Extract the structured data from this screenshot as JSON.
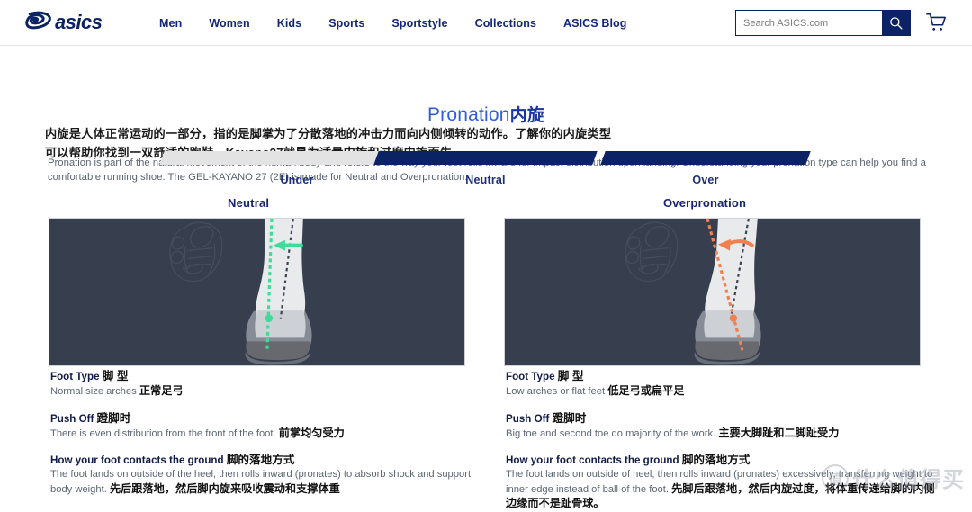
{
  "header": {
    "logo_text": "asics",
    "nav": [
      {
        "label": "Men"
      },
      {
        "label": "Women"
      },
      {
        "label": "Kids"
      },
      {
        "label": "Sports"
      },
      {
        "label": "Sportstyle"
      },
      {
        "label": "Collections"
      },
      {
        "label": "ASICS Blog"
      }
    ],
    "search": {
      "placeholder": "Search ASICS.com",
      "value": ""
    },
    "cart_label": "Cart",
    "colors": {
      "navy": "#0b2265",
      "nav_text": "#14267a"
    }
  },
  "title": {
    "en": "Pronation",
    "cn": "内旋",
    "cn_lead": "内旋是人体正常运动的一部分，指的是脚掌为了分散落地的冲击力而向内侧倾转的动作。了解你的内旋类型可以帮助你找到一双舒适的跑鞋。Kayano27就是为适量内旋和过度内旋而生。",
    "en_lead": "Pronation is part of the natural movement of the human body and refers to the way your foot rolls inward for impact distribution upon landing. Understanding your pronation type can help you find a comfortable running shoe. The GEL-KAYANO 27 (2E) is made for Neutral and Overpronation."
  },
  "scale": {
    "items": [
      {
        "label": "Under",
        "active": false,
        "color": "#e3e3e3"
      },
      {
        "label": "Neutral",
        "active": true,
        "color": "#0b2265"
      },
      {
        "label": "Over",
        "active": true,
        "color": "#0b2265"
      }
    ]
  },
  "columns": [
    {
      "heading": "Neutral",
      "accent": "#3ddc97",
      "blocks": [
        {
          "title_en": "Foot Type",
          "title_cn": "脚 型",
          "body_en": "Normal size arches",
          "body_cn": "正常足弓"
        },
        {
          "title_en": "Push Off",
          "title_cn": "蹬脚时",
          "body_en": "There is even distribution from the front of the foot.",
          "body_cn": "前掌均匀受力"
        },
        {
          "title_en": "How your foot contacts the ground",
          "title_cn": "脚的落地方式",
          "body_en": "The foot lands on outside of the heel, then rolls inward (pronates) to absorb shock and support body weight.",
          "body_cn": "先后跟落地，然后脚内旋来吸收震动和支撑体重"
        }
      ]
    },
    {
      "heading": "Overpronation",
      "accent": "#f08050",
      "blocks": [
        {
          "title_en": "Foot Type",
          "title_cn": "脚 型",
          "body_en": "Low arches or flat feet",
          "body_cn": "低足弓或扁平足"
        },
        {
          "title_en": "Push Off",
          "title_cn": "蹬脚时",
          "body_en": "Big toe and second toe do majority of the work.",
          "body_cn": "主要大脚趾和二脚趾受力"
        },
        {
          "title_en": "How your foot contacts the ground",
          "title_cn": "脚的落地方式",
          "body_en": "The foot lands on outside of heel, then rolls inward (pronates) excessively, transferring weight to inner edge instead of ball of the foot.",
          "body_cn": "先脚后跟落地，然后内旋过度，将体重传递给脚的内侧边缘而不是趾骨球。"
        }
      ]
    }
  ],
  "illustration": {
    "panel_bg": "#373f4e",
    "neutral_accent": "#3ddc97",
    "over_accent": "#f08050",
    "vertical_line": "#4b5263"
  },
  "watermark": {
    "mark": "值",
    "text": "什么值得买"
  }
}
